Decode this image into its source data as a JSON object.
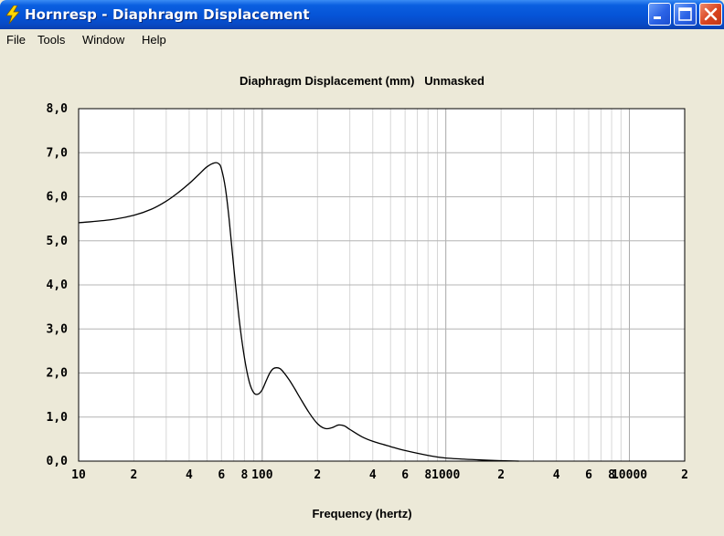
{
  "window": {
    "title": "Hornresp - Diaphragm Displacement",
    "icon": "lightning-bolt-icon",
    "controls": [
      "minimize-icon",
      "maximize-icon",
      "close-icon"
    ]
  },
  "menu": {
    "items": [
      {
        "label": "File"
      },
      {
        "label": "Tools"
      },
      {
        "label": "Window"
      },
      {
        "label": "Help"
      }
    ]
  },
  "colors": {
    "titlebar": "#0553d6",
    "background": "#ece9d8",
    "plot_bg": "#ffffff",
    "grid": "#b4b4b4",
    "curve": "#000000"
  },
  "chart_data": {
    "type": "line",
    "title": "Diaphragm Displacement (mm)   Unmasked",
    "xlabel": "Frequency (hertz)",
    "ylabel": "",
    "x_scale": "log",
    "xlim": [
      10,
      20000
    ],
    "ylim": [
      0,
      8
    ],
    "grid": true,
    "y_ticks": [
      "0,0",
      "1,0",
      "2,0",
      "3,0",
      "4,0",
      "5,0",
      "6,0",
      "7,0",
      "8,0"
    ],
    "x_ticks": [
      {
        "value": 10,
        "label": "10"
      },
      {
        "value": 20,
        "label": "2"
      },
      {
        "value": 40,
        "label": "4"
      },
      {
        "value": 60,
        "label": "6"
      },
      {
        "value": 80,
        "label": "8"
      },
      {
        "value": 100,
        "label": "100"
      },
      {
        "value": 200,
        "label": "2"
      },
      {
        "value": 400,
        "label": "4"
      },
      {
        "value": 600,
        "label": "6"
      },
      {
        "value": 800,
        "label": "8"
      },
      {
        "value": 1000,
        "label": "1000"
      },
      {
        "value": 2000,
        "label": "2"
      },
      {
        "value": 4000,
        "label": "4"
      },
      {
        "value": 6000,
        "label": "6"
      },
      {
        "value": 8000,
        "label": "8"
      },
      {
        "value": 10000,
        "label": "10000"
      },
      {
        "value": 20000,
        "label": "2"
      }
    ],
    "series": [
      {
        "x": [
          10,
          15,
          20,
          25,
          30,
          35,
          40,
          45,
          50,
          55,
          58,
          60,
          63,
          66,
          70,
          75,
          80,
          85,
          90,
          95,
          100,
          105,
          110,
          115,
          120,
          125,
          130,
          140,
          150,
          160,
          180,
          200,
          220,
          240,
          260,
          280,
          300,
          350,
          400,
          500,
          600,
          800,
          1000,
          1500,
          2000,
          2500
        ],
        "y": [
          5.41,
          5.48,
          5.58,
          5.72,
          5.9,
          6.1,
          6.3,
          6.5,
          6.68,
          6.77,
          6.75,
          6.63,
          6.2,
          5.5,
          4.4,
          3.2,
          2.35,
          1.8,
          1.55,
          1.52,
          1.62,
          1.82,
          2.0,
          2.1,
          2.12,
          2.1,
          2.03,
          1.85,
          1.65,
          1.45,
          1.1,
          0.85,
          0.74,
          0.76,
          0.82,
          0.8,
          0.72,
          0.55,
          0.45,
          0.33,
          0.24,
          0.13,
          0.07,
          0.03,
          0.01,
          0.0
        ]
      }
    ]
  }
}
